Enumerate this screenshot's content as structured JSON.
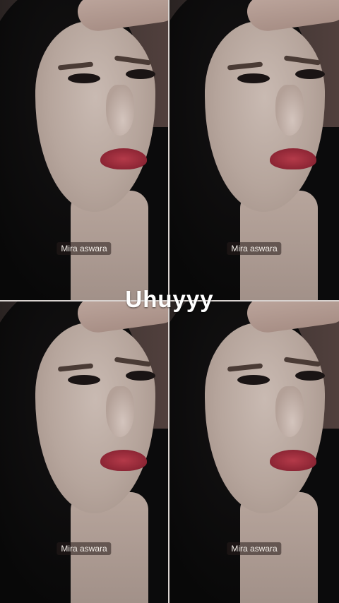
{
  "story": {
    "caption": "Uhuyyy",
    "tiles": [
      {
        "watermark": "Mira aswara"
      },
      {
        "watermark": "Mira aswara"
      },
      {
        "watermark": "Mira aswara"
      },
      {
        "watermark": "Mira aswara"
      }
    ]
  }
}
